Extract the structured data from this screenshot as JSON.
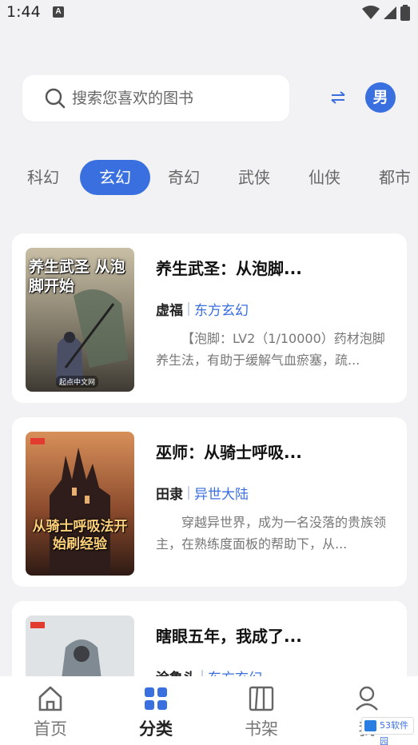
{
  "status_bar": {
    "time": "1:44",
    "notification_badge": "A"
  },
  "search": {
    "placeholder": "搜索您喜欢的图书"
  },
  "gender_toggle": {
    "label": "男"
  },
  "tabs": [
    {
      "label": "科幻",
      "active": false
    },
    {
      "label": "玄幻",
      "active": true
    },
    {
      "label": "奇幻",
      "active": false
    },
    {
      "label": "武侠",
      "active": false
    },
    {
      "label": "仙侠",
      "active": false
    },
    {
      "label": "都市",
      "active": false
    }
  ],
  "books": [
    {
      "title": "养生武圣：从泡脚...",
      "author": "虚福",
      "genre": "东方玄幻",
      "description": "【泡脚：LV2（1/10000）药材泡脚养生法，有助于缓解气血瘀塞，疏...",
      "cover_text": "养生武圣 从泡脚开始",
      "cover_badge": "起点中文网"
    },
    {
      "title": "巫师：从骑士呼吸...",
      "author": "田隶",
      "genre": "异世大陆",
      "description": "穿越异世界，成为一名没落的贵族领主，在熟练度面板的帮助下，从...",
      "cover_text": "从骑士呼吸法开始刷经验"
    },
    {
      "title": "瞎眼五年，我成了...",
      "author": "涂鲁头",
      "genre": "东方玄幻",
      "description": ""
    }
  ],
  "bottom_nav": [
    {
      "label": "首页",
      "icon": "home-icon",
      "active": false
    },
    {
      "label": "分类",
      "icon": "grid-icon",
      "active": true
    },
    {
      "label": "书架",
      "icon": "bookshelf-icon",
      "active": false
    },
    {
      "label": "我",
      "icon": "profile-icon",
      "active": false
    }
  ],
  "watermark": {
    "text": "53软件园"
  },
  "colors": {
    "accent": "#3a6fe0",
    "background": "#f2f2f4"
  }
}
